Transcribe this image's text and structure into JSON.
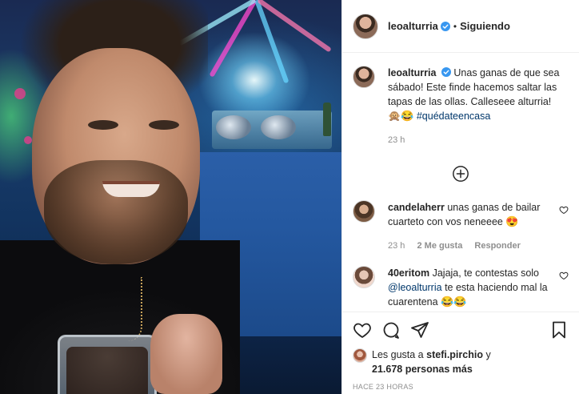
{
  "header": {
    "username": "leoalturria",
    "separator": "•",
    "follow_status": "Siguiendo"
  },
  "caption": {
    "username": "leoalturria",
    "text": "Unas ganas de que sea sábado! Este finde hacemos saltar las tapas de las ollas. Calleseee alturria!",
    "emojis": "🙊😂",
    "hashtag": "#quédateencasa",
    "time": "23 h"
  },
  "comments": [
    {
      "username": "candelaherr",
      "text": "unas ganas de bailar cuarteto con vos neneeee",
      "emoji": "😍",
      "time": "23 h",
      "likes": "2 Me gusta",
      "reply": "Responder"
    },
    {
      "username": "40eritom",
      "text": "Jajaja, te contestas solo",
      "mention": "@leoalturria",
      "text_after": "te esta haciendo mal la cuarentena",
      "emoji": "😂😂"
    }
  ],
  "likes": {
    "prefix": "Les gusta a",
    "user": "stefi.pirchio",
    "conjunction": "y",
    "count": "21.678 personas más"
  },
  "timestamp": "HACE 23 HORAS",
  "colors": {
    "verified": "#3897f0",
    "link": "#00376b",
    "muted": "#8e8e8e",
    "border": "#efefef"
  },
  "icons": [
    "verified-icon",
    "add-circle-icon",
    "heart-icon",
    "comment-icon",
    "share-icon",
    "bookmark-icon"
  ]
}
